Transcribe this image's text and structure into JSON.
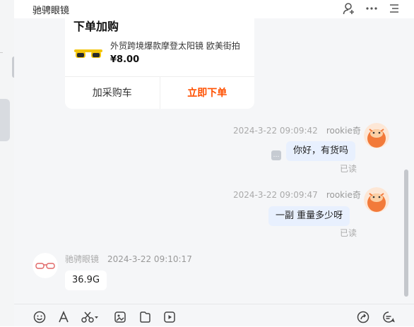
{
  "header": {
    "title": "驰骋眼镜",
    "icons": [
      "add-user-icon",
      "more-icon",
      "menu-icon"
    ]
  },
  "product_card": {
    "title": "下单加购",
    "product_name": "外贸跨境爆款摩登太阳镜 欧美街拍",
    "price": "¥8.00",
    "add_cart_label": "加采购车",
    "buy_label": "立即下单",
    "buy_color": "#ff5000"
  },
  "messages": [
    {
      "time": "2024-3-22 09:09:42",
      "sender": "rookie奇",
      "text": "你好，有货吗",
      "status": "已读"
    },
    {
      "time": "2024-3-22 09:09:47",
      "sender": "rookie奇",
      "text": "一副   重量多少呀",
      "status": "已读"
    },
    {
      "time": "2024-3-22 09:10:17",
      "sender": "驰骋眼镜",
      "text": "36.9G"
    }
  ],
  "toolbar": {
    "icons": [
      "emoji-icon",
      "font-icon",
      "scissors-icon",
      "image-icon",
      "file-icon",
      "video-icon",
      "share-icon",
      "chat-settings-icon"
    ]
  },
  "colors": {
    "bubble_out": "#e8f0fe",
    "bubble_in": "#ffffff",
    "background": "#f5f6f8"
  }
}
